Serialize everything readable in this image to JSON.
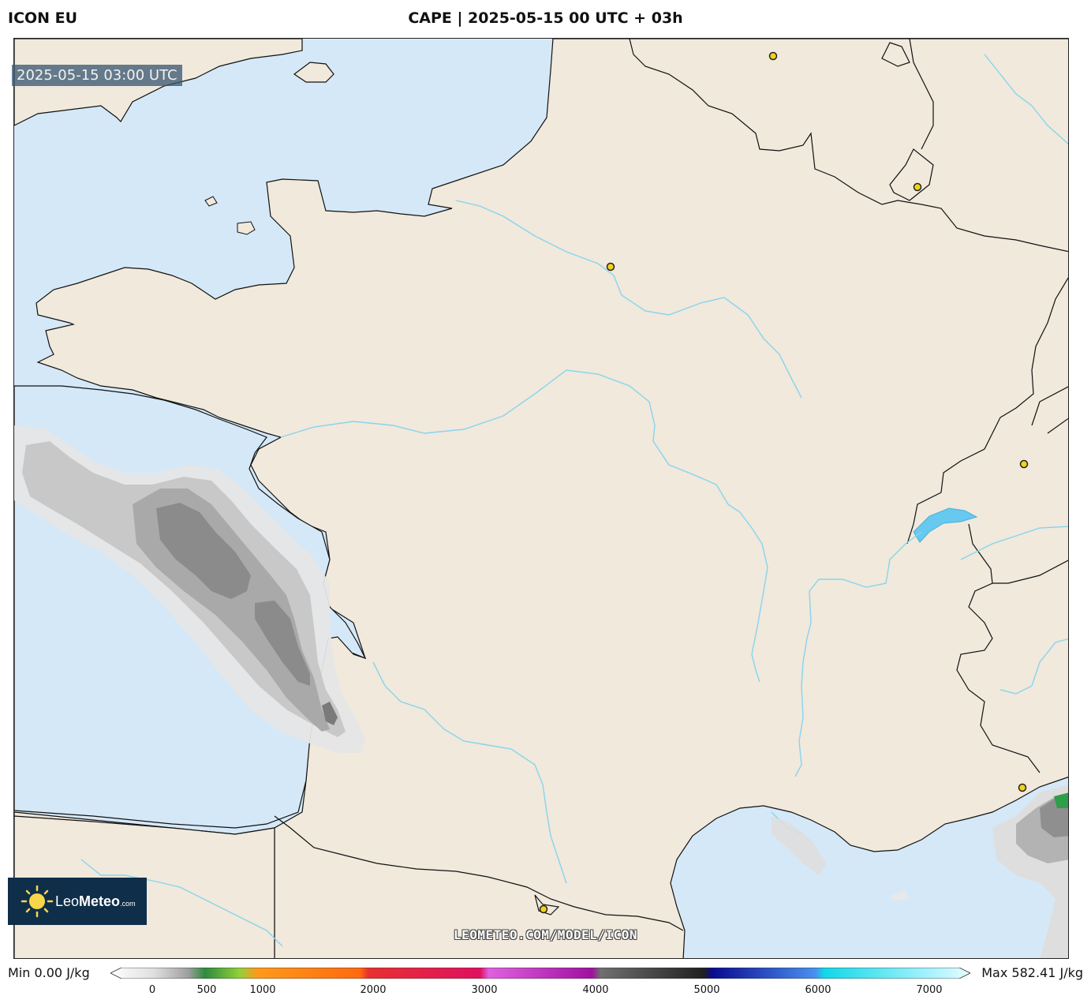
{
  "header": {
    "model": "ICON EU",
    "title": "CAPE | 2025-05-15 00 UTC + 03h"
  },
  "map": {
    "timestamp": "2025-05-15 03:00 UTC",
    "watermark": "LEOMETEO.COM/MODEL/ICON",
    "colors": {
      "sea": "#d5e8f7",
      "land": "#f0e9dc",
      "rivers": "#88d4ef",
      "border": "#111111",
      "city_marker": "#f2d21b"
    }
  },
  "logo": {
    "brand_light": "Leo",
    "brand_bold": "Meteo",
    "suffix": ".com",
    "icon": "sun-icon"
  },
  "legend": {
    "min_label": "Min 0.00 J/kg",
    "max_label": "Max 582.41 J/kg",
    "ticks": [
      "0",
      "500",
      "1000",
      "2000",
      "3000",
      "4000",
      "5000",
      "6000",
      "7000"
    ]
  }
}
